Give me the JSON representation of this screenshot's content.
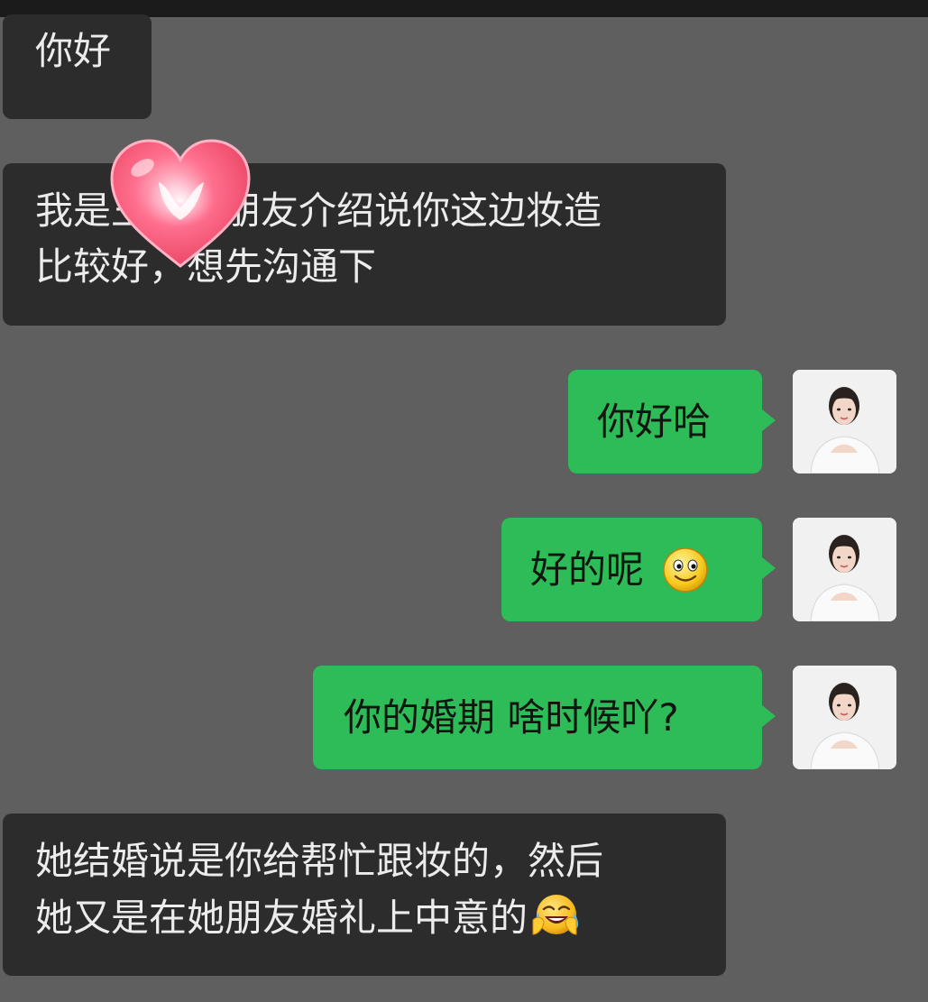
{
  "chat": {
    "messages": [
      {
        "side": "incoming",
        "lines": [
          "你好"
        ]
      },
      {
        "side": "incoming",
        "lines": [
          "我是王",
          "朋友介绍说你这边妆造",
          "比较好，想先沟通下"
        ]
      },
      {
        "side": "outgoing",
        "text": "你好哈"
      },
      {
        "side": "outgoing",
        "text": "好的呢",
        "emoji": "smile-emoji"
      },
      {
        "side": "outgoing",
        "text": "你的婚期 啥时候吖?"
      },
      {
        "side": "incoming",
        "lines": [
          "她结婚说是你给帮忙跟妆的，然后",
          "她又是在她朋友婚礼上中意的"
        ],
        "emoji": "laugh-cry-emoji"
      }
    ]
  },
  "colors": {
    "background": "#5f5f5f",
    "incoming_bubble": "#2c2c2c",
    "outgoing_bubble": "#2ebc58",
    "top_bar": "#1b1b1b"
  },
  "stickers": {
    "overlay": "heart-sticker"
  },
  "avatar": {
    "icon": "user-avatar"
  }
}
